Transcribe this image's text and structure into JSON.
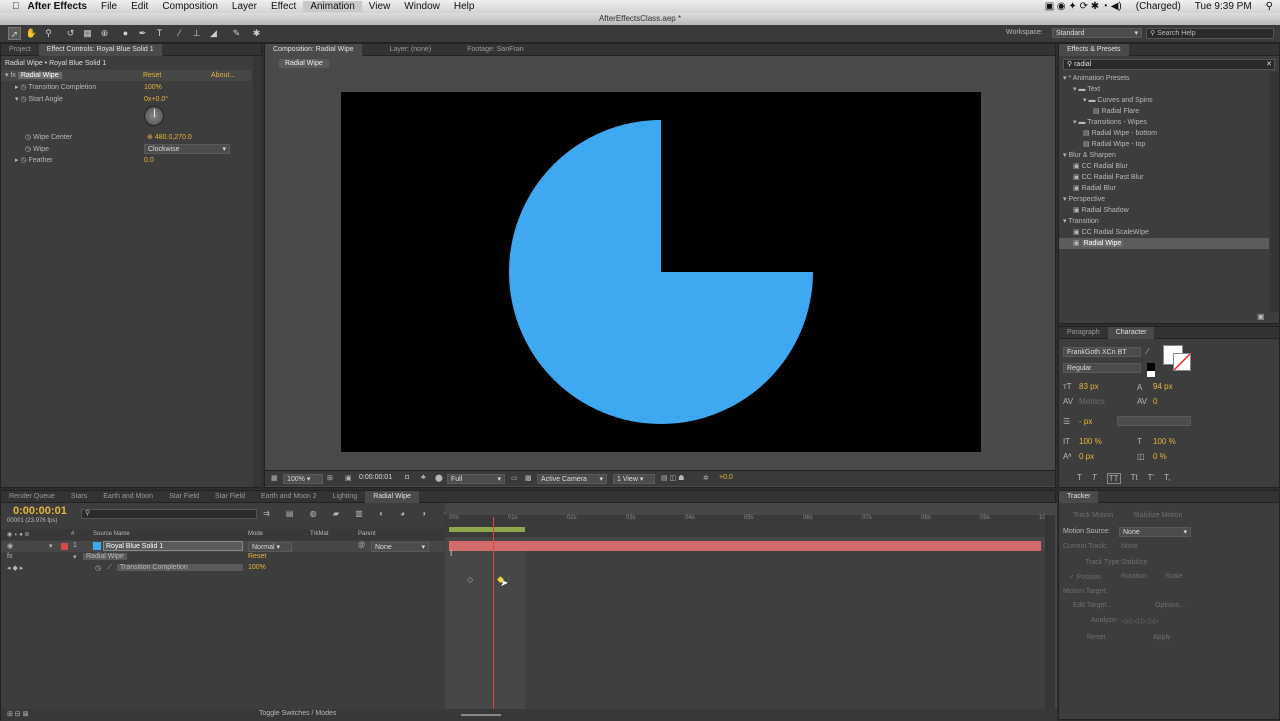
{
  "menubar": {
    "app": "After Effects",
    "items": [
      "File",
      "Edit",
      "Composition",
      "Layer",
      "Effect",
      "Animation",
      "View",
      "Window",
      "Help"
    ],
    "selected": "Animation",
    "battery": "(Charged)",
    "clock": "Tue 9:39 PM"
  },
  "window": {
    "title": "AfterEffectsClass.aep *"
  },
  "toolbar": {
    "workspace_label": "Workspace:",
    "workspace_value": "Standard",
    "search_placeholder": "Search Help"
  },
  "left_panel": {
    "tabs": [
      "Project",
      "Effect Controls: Royal Blue Solid 1"
    ],
    "breadcrumb": "Radial Wipe • Royal Blue Solid 1",
    "effect": {
      "name": "Radial Wipe",
      "reset": "Reset",
      "about": "About..."
    },
    "props": [
      {
        "label": "Transition Completion",
        "value": "100%"
      },
      {
        "label": "Start Angle",
        "value": "0x+0.0°"
      },
      {
        "label": "Wipe Center",
        "value": "480.0,270.0"
      },
      {
        "label": "Wipe",
        "value": "Clockwise"
      },
      {
        "label": "Feather",
        "value": "0.0"
      }
    ]
  },
  "composition": {
    "tabs": [
      "Composition: Radial Wipe",
      "Layer: (none)",
      "Footage: SanFran"
    ],
    "chip": "Radial Wipe",
    "footer": {
      "zoom": "100%",
      "time": "0:00:00:01",
      "resolution": "Full",
      "camera": "Active Camera",
      "view": "1 View",
      "exposure": "+0.0"
    },
    "wipe": {
      "completion": 0.75,
      "color": "#3ea8f0",
      "bg": "#000000"
    }
  },
  "effects_presets": {
    "title": "Effects & Presets",
    "search": "radial",
    "tree": [
      {
        "label": "* Animation Presets",
        "level": 0,
        "kind": "arrow"
      },
      {
        "label": "Text",
        "level": 1,
        "kind": "folder"
      },
      {
        "label": "Curves and Spins",
        "level": 2,
        "kind": "folder"
      },
      {
        "label": "Radial Flare",
        "level": 3,
        "kind": "preset"
      },
      {
        "label": "Transitions - Wipes",
        "level": 1,
        "kind": "folder"
      },
      {
        "label": "Radial Wipe - bottom",
        "level": 2,
        "kind": "preset"
      },
      {
        "label": "Radial Wipe - top",
        "level": 2,
        "kind": "preset"
      },
      {
        "label": "Blur & Sharpen",
        "level": 0,
        "kind": "arrow"
      },
      {
        "label": "CC Radial Blur",
        "level": 1,
        "kind": "fx"
      },
      {
        "label": "CC Radial Fast Blur",
        "level": 1,
        "kind": "fx"
      },
      {
        "label": "Radial Blur",
        "level": 1,
        "kind": "fx"
      },
      {
        "label": "Perspective",
        "level": 0,
        "kind": "arrow"
      },
      {
        "label": "Radial Shadow",
        "level": 1,
        "kind": "fx"
      },
      {
        "label": "Transition",
        "level": 0,
        "kind": "arrow"
      },
      {
        "label": "CC Radial ScaleWipe",
        "level": 1,
        "kind": "fx"
      },
      {
        "label": "Radial Wipe",
        "level": 1,
        "kind": "fx",
        "selected": true
      }
    ]
  },
  "character": {
    "tabs": [
      "Paragraph",
      "Character"
    ],
    "font": "FrankGoth XCn BT",
    "style": "Regular",
    "size": "83 px",
    "leading": "94 px",
    "kerning": "Metrics",
    "tracking": "0",
    "stroke": "- px",
    "vscale": "100 %",
    "hscale": "100 %",
    "baseline": "0 px",
    "tsume": "0 %",
    "styles": [
      "T",
      "T",
      "TT",
      "Tt",
      "T'",
      "T,"
    ]
  },
  "tracker": {
    "title": "Tracker",
    "track_motion": "Track Motion",
    "stabilize": "Stabilize Motion",
    "motion_source_label": "Motion Source:",
    "motion_source": "None",
    "current_track_label": "Current Track:",
    "current_track": "None",
    "track_type_label": "Track Type:",
    "track_type": "Stabilize",
    "checks": [
      "Position",
      "Rotation",
      "Scale"
    ],
    "motion_target": "Motion Target:",
    "edit_target": "Edit Target...",
    "options": "Options...",
    "analyze": "Analyze:",
    "reset": "Reset",
    "apply": "Apply"
  },
  "timeline": {
    "tabs": [
      "Render Queue",
      "Stars",
      "Earth and Moon",
      "Star Field",
      "Star Field",
      "Earth and Moon 2",
      "Lighting",
      "Radial Wipe"
    ],
    "active_tab": "Radial Wipe",
    "timecode": "0:00:00:01",
    "frames": "00001 (23.976 fps)",
    "headers": {
      "source": "Source Name",
      "mode": "Mode",
      "trkmat": "TrkMat",
      "parent": "Parent"
    },
    "layer": {
      "number": "1",
      "name": "Royal Blue Solid 1",
      "mode": "Normal",
      "parent": "None",
      "color": "#d64a4a"
    },
    "effect_row": {
      "name": "Radial Wipe",
      "reset": "Reset"
    },
    "prop_row": {
      "name": "Transition Completion",
      "value": "100%"
    },
    "ruler": [
      "00s",
      "01s",
      "02s",
      "03s",
      "04s",
      "05s",
      "06s",
      "07s",
      "08s",
      "09s",
      "10s"
    ],
    "toggle": "Toggle Switches / Modes"
  }
}
